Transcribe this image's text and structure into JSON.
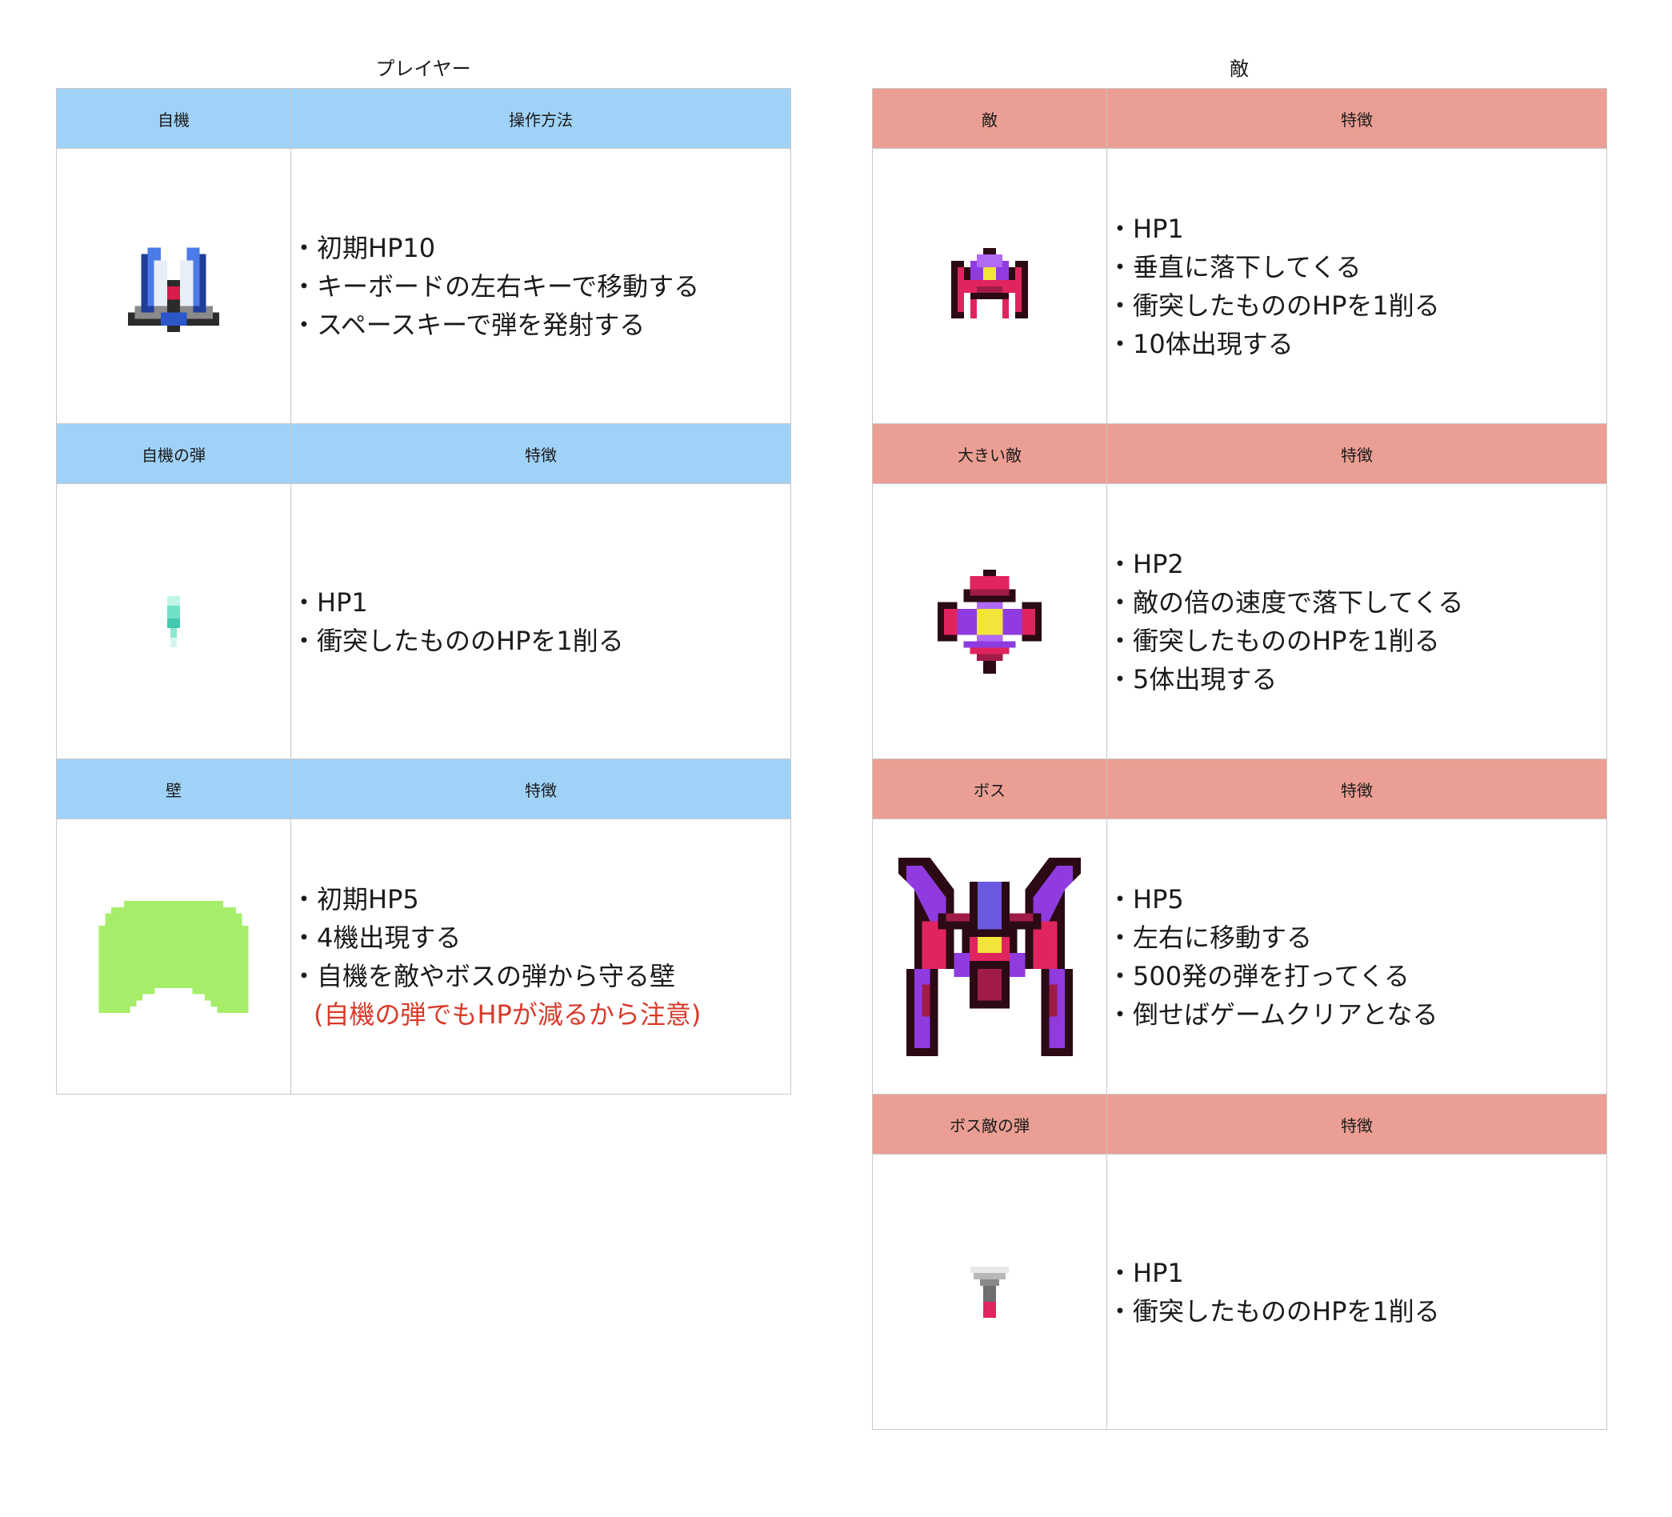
{
  "player": {
    "title": "プレイヤー",
    "sections": [
      {
        "header_left": "自機",
        "header_right": "操作方法",
        "sprite": "player-ship-icon",
        "lines": [
          "・初期HP10",
          "・キーボードの左右キーで移動する",
          "・スペースキーで弾を発射する"
        ],
        "note": ""
      },
      {
        "header_left": "自機の弾",
        "header_right": "特徴",
        "sprite": "player-bullet-icon",
        "lines": [
          "・HP1",
          "・衝突したもののHPを1削る"
        ],
        "note": ""
      },
      {
        "header_left": "壁",
        "header_right": "特徴",
        "sprite": "wall-icon",
        "lines": [
          "・初期HP5",
          "・4機出現する",
          "・自機を敵やボスの弾から守る壁"
        ],
        "note": "(自機の弾でもHPが減るから注意)"
      }
    ]
  },
  "enemy": {
    "title": "敵",
    "sections": [
      {
        "header_left": "敵",
        "header_right": "特徴",
        "sprite": "enemy-ship-icon",
        "lines": [
          "・HP1",
          "・垂直に落下してくる",
          "・衝突したもののHPを1削る",
          "・10体出現する"
        ]
      },
      {
        "header_left": "大きい敵",
        "header_right": "特徴",
        "sprite": "big-enemy-ship-icon",
        "lines": [
          "・HP2",
          "・敵の倍の速度で落下してくる",
          "・衝突したもののHPを1削る",
          "・5体出現する"
        ]
      },
      {
        "header_left": "ボス",
        "header_right": "特徴",
        "sprite": "boss-ship-icon",
        "lines": [
          "・HP5",
          "・左右に移動する",
          "・500発の弾を打ってくる",
          "・倒せばゲームクリアとなる"
        ]
      },
      {
        "header_left": "ボス敵の弾",
        "header_right": "特徴",
        "sprite": "boss-bullet-icon",
        "lines": [
          "・HP1",
          "・衝突したもののHPを1削る"
        ]
      }
    ]
  },
  "colors": {
    "player_header": "#a0d2f8",
    "enemy_header": "#eb9e93",
    "note_text": "#d83a2b",
    "wall_fill": "#a6ee6a"
  }
}
